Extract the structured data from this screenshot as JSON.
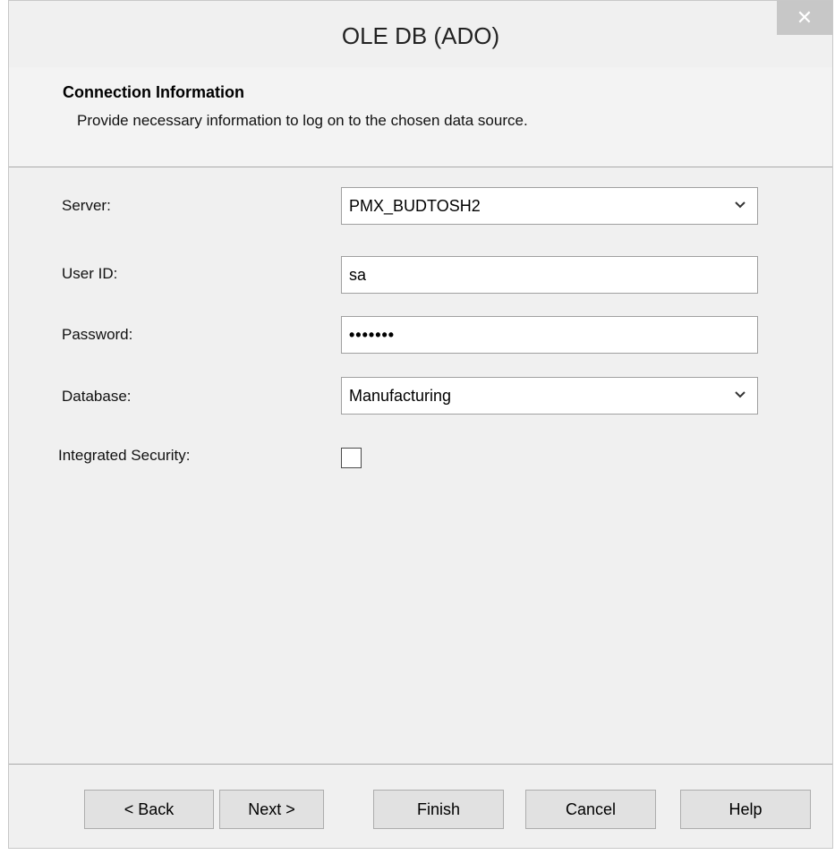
{
  "window": {
    "title": "OLE DB (ADO)",
    "close_symbol": "✕"
  },
  "header": {
    "title": "Connection Information",
    "description": "Provide necessary information to log on to the chosen data source."
  },
  "form": {
    "server_label": "Server:",
    "server_value": "PMX_BUDTOSH2",
    "userid_label": "User ID:",
    "userid_value": "sa",
    "password_label": "Password:",
    "password_value": "•••••••",
    "database_label": "Database:",
    "database_value": "Manufacturing",
    "integrated_security_label": "Integrated Security:",
    "integrated_security_checked": false
  },
  "buttons": {
    "back": "< Back",
    "next": "Next >",
    "finish": "Finish",
    "cancel": "Cancel",
    "help": "Help"
  },
  "icons": {
    "dropdown": "chevron-down-icon",
    "close": "close-icon"
  }
}
